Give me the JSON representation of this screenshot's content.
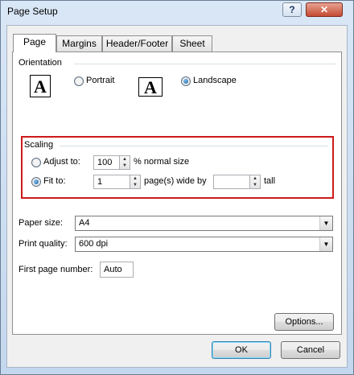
{
  "window": {
    "title": "Page Setup",
    "help_glyph": "?",
    "close_glyph": "✕"
  },
  "tabs": [
    {
      "label": "Page",
      "active": true
    },
    {
      "label": "Margins"
    },
    {
      "label": "Header/Footer"
    },
    {
      "label": "Sheet"
    }
  ],
  "orientation": {
    "group_label": "Orientation",
    "icon_letter": "A",
    "portrait_label": "Portrait",
    "landscape_label": "Landscape",
    "selected": "landscape"
  },
  "scaling": {
    "group_label": "Scaling",
    "adjust_to_label": "Adjust to:",
    "adjust_to_value": "100",
    "adjust_suffix": "% normal size",
    "fit_to_label": "Fit to:",
    "fit_wide_value": "1",
    "fit_wide_suffix": "page(s) wide by",
    "fit_tall_value": "",
    "fit_tall_suffix": "tall",
    "selected": "fit_to",
    "highlight_color": "#cc1a1a"
  },
  "paper_size": {
    "label": "Paper size:",
    "value": "A4"
  },
  "print_quality": {
    "label": "Print quality:",
    "value": "600 dpi"
  },
  "first_page_number": {
    "label": "First page number:",
    "value": "Auto"
  },
  "buttons": {
    "options": "Options...",
    "ok": "OK",
    "cancel": "Cancel"
  }
}
